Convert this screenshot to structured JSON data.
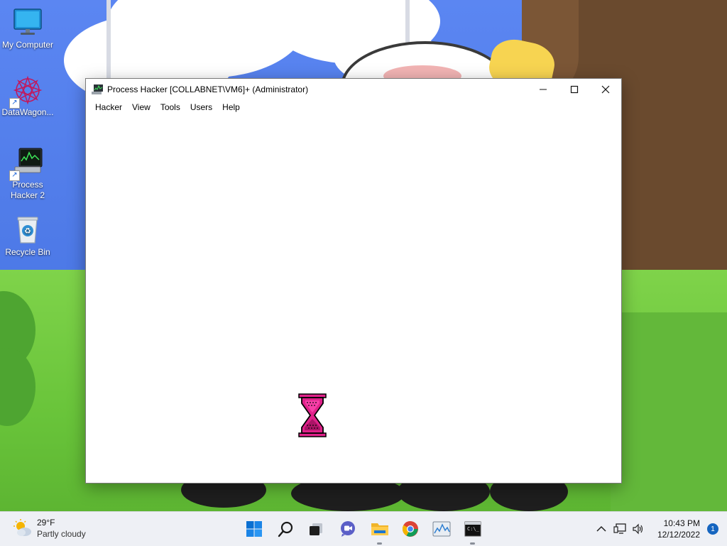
{
  "desktop": {
    "icons": [
      {
        "label": "My Computer",
        "icon": "monitor-icon"
      },
      {
        "label": "DataWagon...",
        "icon": "datawagon-icon"
      },
      {
        "label": "Process Hacker 2",
        "icon": "process-hacker-icon"
      },
      {
        "label": "Recycle Bin",
        "icon": "recycle-bin-icon"
      }
    ]
  },
  "window": {
    "title": "Process Hacker [COLLABNET\\VM6]+ (Administrator)",
    "controls": {
      "minimize": "—",
      "maximize": "☐",
      "close": "✕"
    },
    "menu": [
      "Hacker",
      "View",
      "Tools",
      "Users",
      "Help"
    ],
    "cursor": "hourglass-busy-icon"
  },
  "taskbar": {
    "weather": {
      "temp": "29°F",
      "condition": "Partly cloudy",
      "icon": "partly-cloudy-icon"
    },
    "apps": [
      {
        "name": "start-button",
        "icon": "windows-logo-icon"
      },
      {
        "name": "search-button",
        "icon": "search-icon"
      },
      {
        "name": "task-view-button",
        "icon": "task-view-icon"
      },
      {
        "name": "chat-button",
        "icon": "chat-icon"
      },
      {
        "name": "file-explorer-button",
        "icon": "folder-icon"
      },
      {
        "name": "chrome-button",
        "icon": "chrome-icon"
      },
      {
        "name": "process-hacker-taskbar-button",
        "icon": "process-hacker-icon"
      },
      {
        "name": "terminal-button",
        "icon": "terminal-icon"
      }
    ],
    "clock": {
      "time": "10:43 PM",
      "date": "12/12/2022"
    },
    "notifications": "1"
  },
  "colors": {
    "accent": "#0067c0",
    "hourglass": "#e0218a",
    "taskbar_bg": "#eef0f5"
  }
}
